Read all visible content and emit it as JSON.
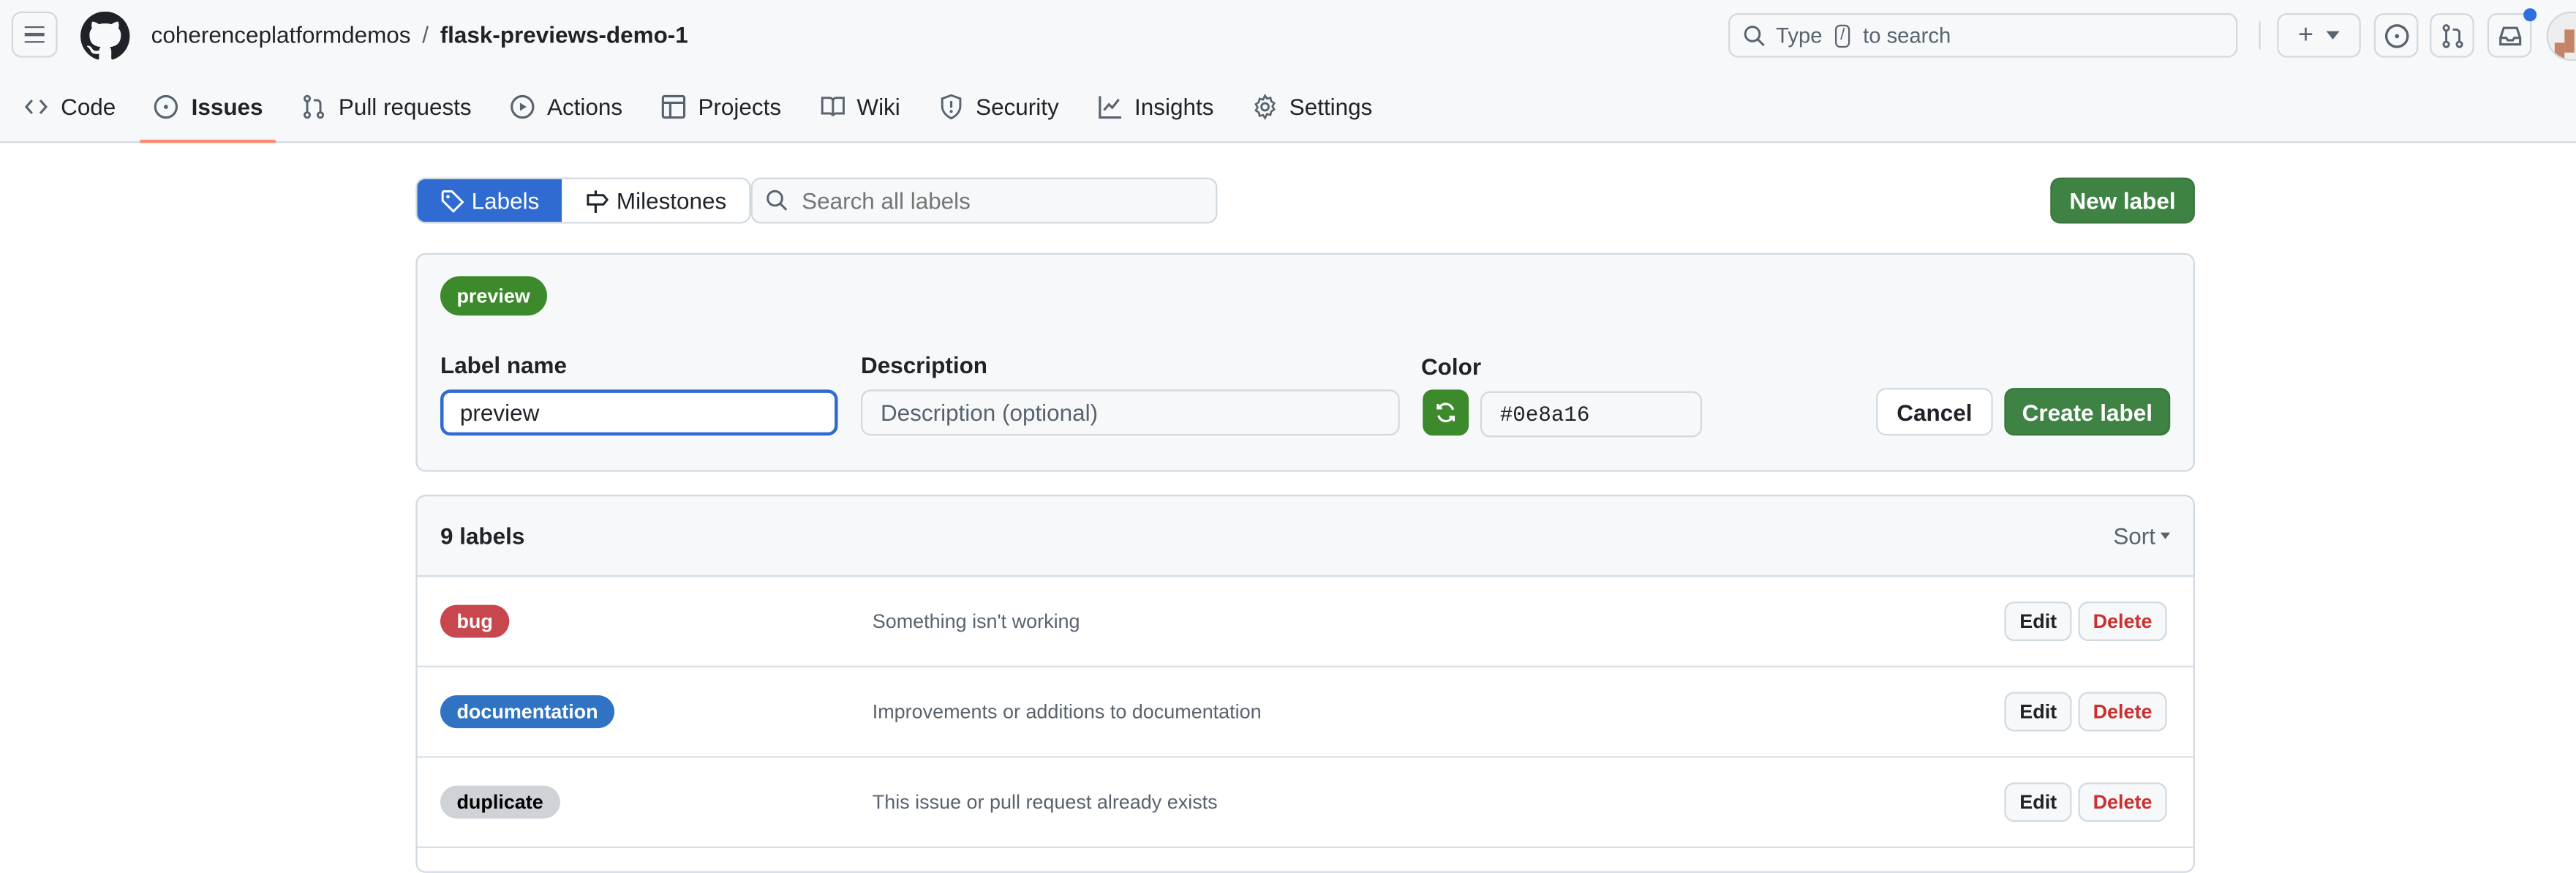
{
  "header": {
    "owner": "coherenceplatformdemos",
    "separator": "/",
    "repo": "flask-previews-demo-1",
    "search_prefix": "Type",
    "search_kbd": "/",
    "search_suffix": "to search",
    "icons": [
      "hamburger-icon",
      "github-logo-icon",
      "search-icon",
      "plus-icon",
      "issue-opened-icon",
      "git-pull-request-icon",
      "inbox-icon"
    ],
    "notification_dot_color": "#2f6fdc"
  },
  "nav": {
    "items": [
      {
        "label": "Code",
        "icon": "code-icon",
        "active": false
      },
      {
        "label": "Issues",
        "icon": "issue-opened-icon",
        "active": true
      },
      {
        "label": "Pull requests",
        "icon": "git-pull-request-icon",
        "active": false
      },
      {
        "label": "Actions",
        "icon": "play-icon",
        "active": false
      },
      {
        "label": "Projects",
        "icon": "table-icon",
        "active": false
      },
      {
        "label": "Wiki",
        "icon": "book-icon",
        "active": false
      },
      {
        "label": "Security",
        "icon": "shield-icon",
        "active": false
      },
      {
        "label": "Insights",
        "icon": "graph-icon",
        "active": false
      },
      {
        "label": "Settings",
        "icon": "gear-icon",
        "active": false
      }
    ],
    "active_underline_color": "#fd8c73"
  },
  "subnav": {
    "labels": "Labels",
    "milestones": "Milestones",
    "search_placeholder": "Search all labels",
    "new_label": "New label"
  },
  "form": {
    "preview_label": "preview",
    "preview_color": "#0e8a16",
    "name_label": "Label name",
    "name_value": "preview",
    "description_label": "Description",
    "description_placeholder": "Description (optional)",
    "color_label": "Color",
    "color_value": "#0e8a16",
    "cancel": "Cancel",
    "create": "Create label"
  },
  "list": {
    "count": "9 labels",
    "sort": "Sort",
    "edit": "Edit",
    "delete": "Delete",
    "labels": [
      {
        "name": "bug",
        "description": "Something isn't working",
        "color": "#c8474f",
        "text_color": "#ffffff"
      },
      {
        "name": "documentation",
        "description": "Improvements or additions to documentation",
        "color": "#3073c3",
        "text_color": "#ffffff"
      },
      {
        "name": "duplicate",
        "description": "This issue or pull request already exists",
        "color": "#cfd3d7",
        "text_color": "#000000"
      }
    ]
  }
}
